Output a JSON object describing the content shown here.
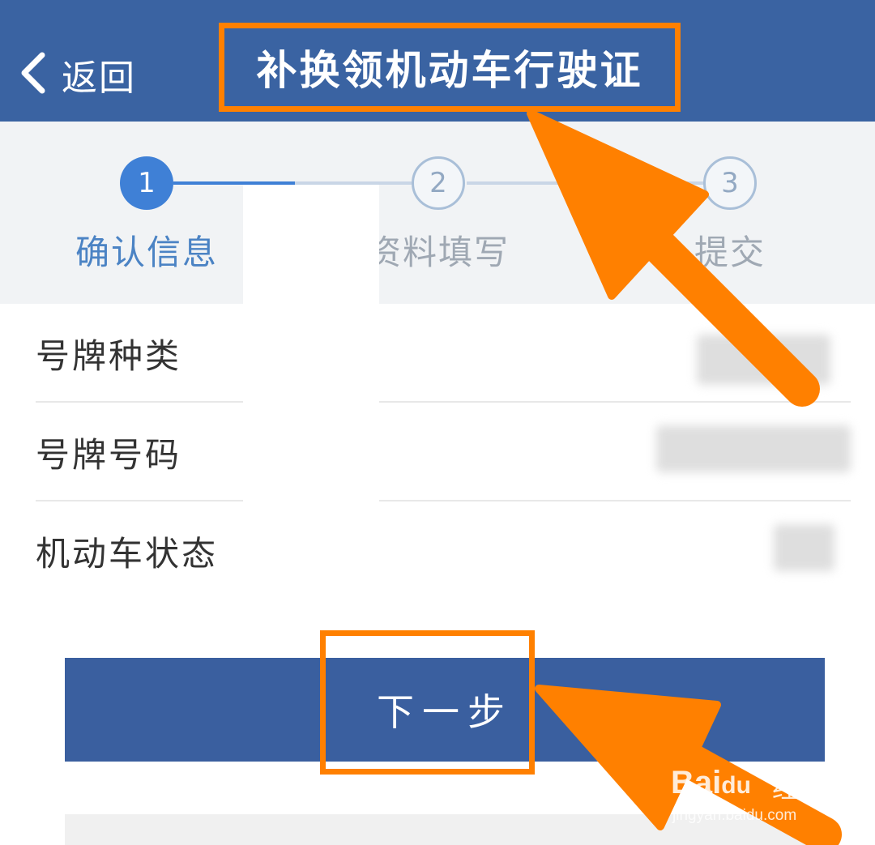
{
  "header": {
    "back_label": "返回",
    "title": "补换领机动车行驶证",
    "background": "#3a63a2"
  },
  "steps": [
    {
      "number": "1",
      "label": "确认信息",
      "state": "active"
    },
    {
      "number": "2",
      "label": "资料填写",
      "state": "pending"
    },
    {
      "number": "3",
      "label": "提交",
      "state": "pending"
    }
  ],
  "info_rows": [
    {
      "label": "号牌种类"
    },
    {
      "label": "号牌号码"
    },
    {
      "label": "机动车状态"
    }
  ],
  "next_button": {
    "label": "下一步",
    "background": "#3a5f9f"
  },
  "annotation": {
    "color": "#ff8000"
  },
  "watermark": {
    "brand": "Bai",
    "brand_suffix": "du",
    "name": "经验",
    "url": "jingyan.baidu.com"
  }
}
